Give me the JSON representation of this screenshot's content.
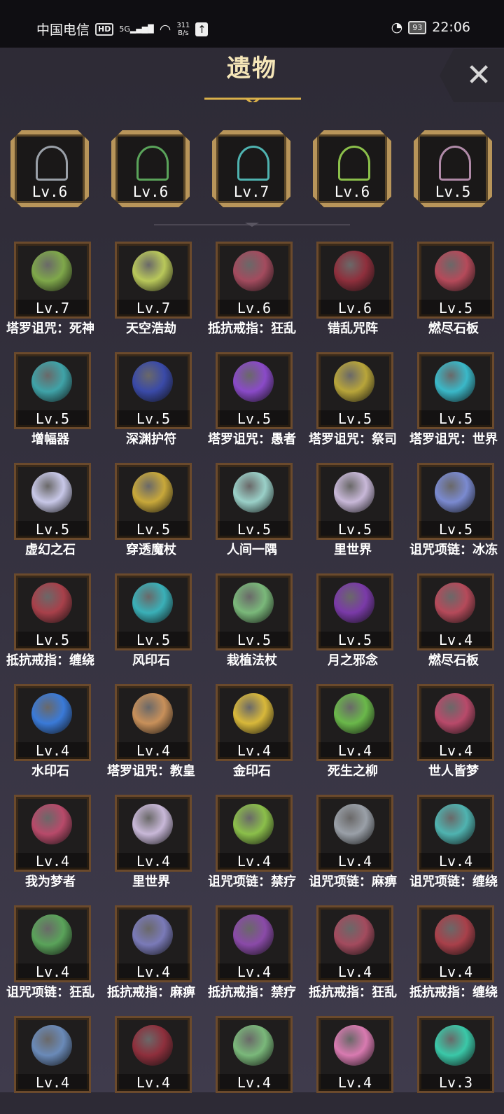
{
  "status_bar": {
    "carrier": "中国电信",
    "hd": "HD",
    "network": "5G",
    "speed_value": "311",
    "speed_unit": "B/s",
    "battery": "93",
    "time": "22:06"
  },
  "title": "遗物",
  "equipped": [
    {
      "level": "Lv.6",
      "color": "#9aa0a8"
    },
    {
      "level": "Lv.6",
      "color": "#5aa35a"
    },
    {
      "level": "Lv.7",
      "color": "#4fb3b0"
    },
    {
      "level": "Lv.6",
      "color": "#8bbf4a"
    },
    {
      "level": "Lv.5",
      "color": "#b08aa8"
    }
  ],
  "relics": [
    {
      "level": "Lv.7",
      "name": "塔罗诅咒：死神",
      "color": "#7fa84a"
    },
    {
      "level": "Lv.7",
      "name": "天空浩劫",
      "color": "#b9c85a"
    },
    {
      "level": "Lv.6",
      "name": "抵抗戒指：狂乱",
      "color": "#a34b5e"
    },
    {
      "level": "Lv.6",
      "name": "错乱咒阵",
      "color": "#8e2f3c"
    },
    {
      "level": "Lv.5",
      "name": "燃尽石板",
      "color": "#b54a5a"
    },
    {
      "level": "Lv.5",
      "name": "增幅器",
      "color": "#3fa3a8"
    },
    {
      "level": "Lv.5",
      "name": "深渊护符",
      "color": "#3a4aa8"
    },
    {
      "level": "Lv.5",
      "name": "塔罗诅咒：愚者",
      "color": "#8a4ac8"
    },
    {
      "level": "Lv.5",
      "name": "塔罗诅咒：祭司",
      "color": "#b8a53a"
    },
    {
      "level": "Lv.5",
      "name": "塔罗诅咒：世界",
      "color": "#3ab8c8"
    },
    {
      "level": "Lv.5",
      "name": "虚幻之石",
      "color": "#c8c8e8"
    },
    {
      "level": "Lv.5",
      "name": "穿透魔杖",
      "color": "#c8a83a"
    },
    {
      "level": "Lv.5",
      "name": "人间一隅",
      "color": "#9ad0c8"
    },
    {
      "level": "Lv.5",
      "name": "里世界",
      "color": "#c8b8d8"
    },
    {
      "level": "Lv.5",
      "name": "诅咒项链：冰冻",
      "color": "#7a8ad0"
    },
    {
      "level": "Lv.5",
      "name": "抵抗戒指：缠绕",
      "color": "#a8404a"
    },
    {
      "level": "Lv.5",
      "name": "风印石",
      "color": "#3ab0b8"
    },
    {
      "level": "Lv.5",
      "name": "栽植法杖",
      "color": "#7ab87a"
    },
    {
      "level": "Lv.5",
      "name": "月之邪念",
      "color": "#7a3aa8"
    },
    {
      "level": "Lv.4",
      "name": "燃尽石板",
      "color": "#b54a5a"
    },
    {
      "level": "Lv.4",
      "name": "水印石",
      "color": "#3a7ad8"
    },
    {
      "level": "Lv.4",
      "name": "塔罗诅咒：教皇",
      "color": "#c8905a"
    },
    {
      "level": "Lv.4",
      "name": "金印石",
      "color": "#d8b83a"
    },
    {
      "level": "Lv.4",
      "name": "死生之柳",
      "color": "#6ab84a"
    },
    {
      "level": "Lv.4",
      "name": "世人皆梦",
      "color": "#b84a6a"
    },
    {
      "level": "Lv.4",
      "name": "我为梦者",
      "color": "#b84a6a"
    },
    {
      "level": "Lv.4",
      "name": "里世界",
      "color": "#c8b8d8"
    },
    {
      "level": "Lv.4",
      "name": "诅咒项链：禁疗",
      "color": "#8bbf4a"
    },
    {
      "level": "Lv.4",
      "name": "诅咒项链：麻痹",
      "color": "#9aa0a8"
    },
    {
      "level": "Lv.4",
      "name": "诅咒项链：缠绕",
      "color": "#4fb3b0"
    },
    {
      "level": "Lv.4",
      "name": "诅咒项链：狂乱",
      "color": "#5aa35a"
    },
    {
      "level": "Lv.4",
      "name": "抵抗戒指：麻痹",
      "color": "#7a7ab8"
    },
    {
      "level": "Lv.4",
      "name": "抵抗戒指：禁疗",
      "color": "#8a4aa8"
    },
    {
      "level": "Lv.4",
      "name": "抵抗戒指：狂乱",
      "color": "#a34b5e"
    },
    {
      "level": "Lv.4",
      "name": "抵抗戒指：缠绕",
      "color": "#a8404a"
    },
    {
      "level": "Lv.4",
      "name": "",
      "color": "#6a8ab8"
    },
    {
      "level": "Lv.4",
      "name": "",
      "color": "#8e2f3c"
    },
    {
      "level": "Lv.4",
      "name": "",
      "color": "#7ab87a"
    },
    {
      "level": "Lv.4",
      "name": "",
      "color": "#d87ab0"
    },
    {
      "level": "Lv.3",
      "name": "",
      "color": "#3ac8a8"
    }
  ]
}
